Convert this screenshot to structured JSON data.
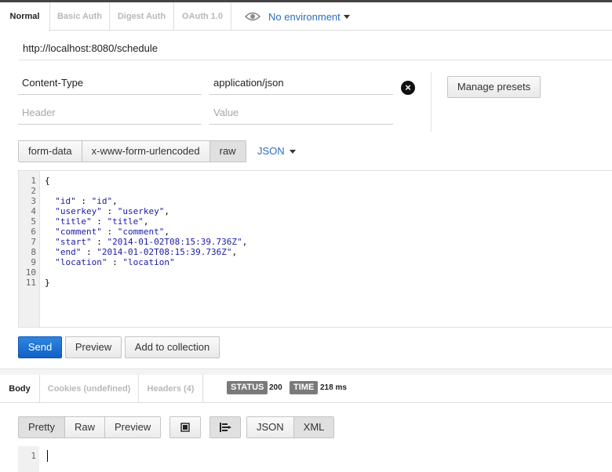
{
  "auth_tabs": [
    {
      "label": "Normal",
      "active": true
    },
    {
      "label": "Basic Auth",
      "active": false
    },
    {
      "label": "Digest Auth",
      "active": false
    },
    {
      "label": "OAuth 1.0",
      "active": false
    }
  ],
  "environment": {
    "label": "No environment",
    "icon": "eye-icon"
  },
  "request": {
    "url": "http://localhost:8080/schedule"
  },
  "headers": {
    "rows": [
      {
        "key": "Content-Type",
        "value": "application/json"
      }
    ],
    "new_key_placeholder": "Header",
    "new_value_placeholder": "Value",
    "remove_icon": "×",
    "manage_presets": "Manage presets"
  },
  "body_modes": [
    {
      "label": "form-data",
      "active": false
    },
    {
      "label": "x-www-form-urlencoded",
      "active": false
    },
    {
      "label": "raw",
      "active": true
    }
  ],
  "raw_format": "JSON",
  "body_code": [
    "{",
    "",
    "  \"id\" : \"id\",",
    "  \"userkey\" : \"userkey\",",
    "  \"title\" : \"title\",",
    "  \"comment\" : \"comment\",",
    "  \"start\" : \"2014-01-02T08:15:39.736Z\",",
    "  \"end\" : \"2014-01-02T08:15:39.736Z\",",
    "  \"location\" : \"location\"",
    "",
    "}"
  ],
  "line_numbers": [
    "1",
    "2",
    "3",
    "4",
    "5",
    "6",
    "7",
    "8",
    "9",
    "10",
    "11"
  ],
  "actions": {
    "send": "Send",
    "preview": "Preview",
    "add_to_collection": "Add to collection"
  },
  "response": {
    "tabs": [
      {
        "label": "Body",
        "active": true
      },
      {
        "label": "Cookies (undefined)",
        "active": false
      },
      {
        "label": "Headers (4)",
        "active": false
      }
    ],
    "status_label": "STATUS",
    "status_value": "200",
    "time_label": "TIME",
    "time_value": "218 ms",
    "view_modes": [
      {
        "label": "Pretty",
        "active": true
      },
      {
        "label": "Raw",
        "active": false
      },
      {
        "label": "Preview",
        "active": false
      }
    ],
    "formats": [
      {
        "label": "JSON",
        "active": false
      },
      {
        "label": "XML",
        "active": true
      }
    ],
    "body_line_number": "1"
  },
  "colors": {
    "primary": "#1a6fd6",
    "link": "#2a6fbf",
    "code": "#1a1aa6"
  }
}
